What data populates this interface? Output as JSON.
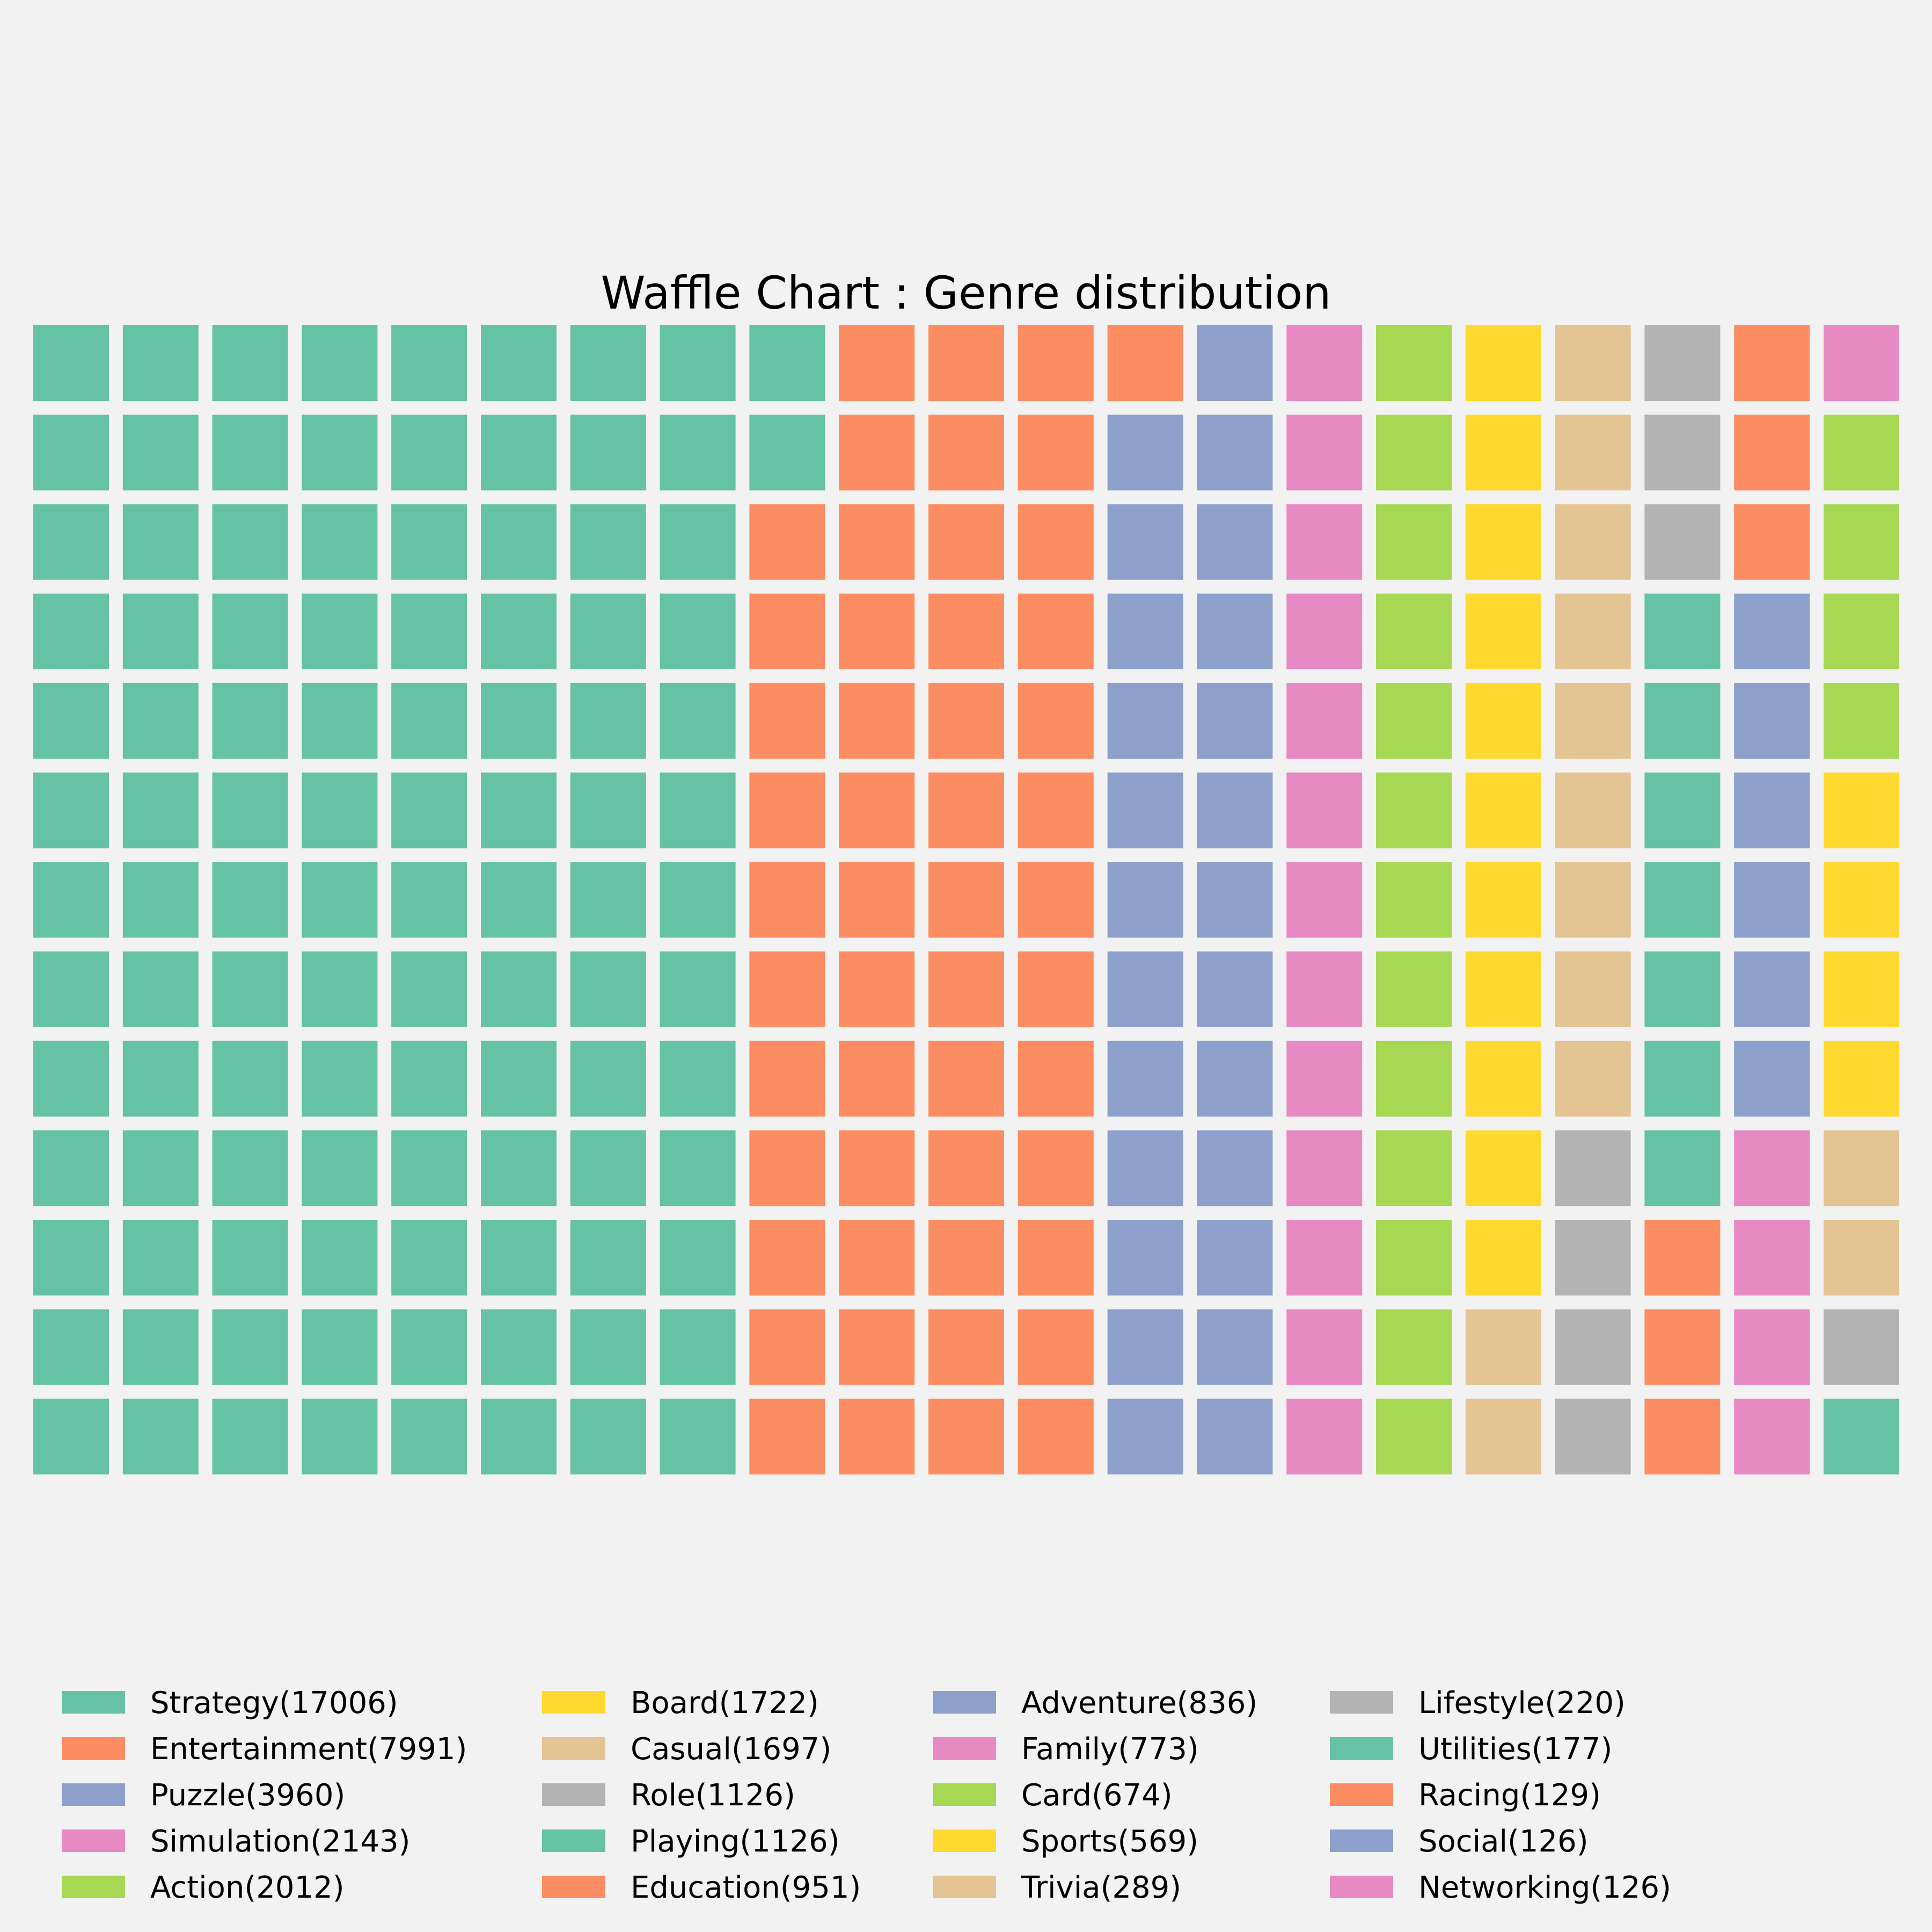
{
  "chart_data": {
    "type": "waffle",
    "title": "Waffle Chart : Genre distribution",
    "rows": 13,
    "columns": 21,
    "fill_order": "column-major, top to bottom",
    "legend_location": "bottom",
    "legend_columns": 4,
    "series": [
      {
        "name": "Strategy(17006)",
        "value": 17006,
        "cells": 106,
        "color": "#66c2a5"
      },
      {
        "name": "Entertainment(7991)",
        "value": 7991,
        "cells": 51,
        "color": "#fc8d62"
      },
      {
        "name": "Puzzle(3960)",
        "value": 3960,
        "cells": 25,
        "color": "#8da0cb"
      },
      {
        "name": "Simulation(2143)",
        "value": 2143,
        "cells": 13,
        "color": "#e78ac3"
      },
      {
        "name": "Action(2012)",
        "value": 2012,
        "cells": 13,
        "color": "#a6d854"
      },
      {
        "name": "Board(1722)",
        "value": 1722,
        "cells": 11,
        "color": "#ffd92f"
      },
      {
        "name": "Casual(1697)",
        "value": 1697,
        "cells": 11,
        "color": "#e5c494"
      },
      {
        "name": "Role(1126)",
        "value": 1126,
        "cells": 7,
        "color": "#b3b3b3"
      },
      {
        "name": "Playing(1126)",
        "value": 1126,
        "cells": 7,
        "color": "#66c2a5"
      },
      {
        "name": "Education(951)",
        "value": 951,
        "cells": 6,
        "color": "#fc8d62"
      },
      {
        "name": "Adventure(836)",
        "value": 836,
        "cells": 6,
        "color": "#8da0cb"
      },
      {
        "name": "Family(773)",
        "value": 773,
        "cells": 5,
        "color": "#e78ac3"
      },
      {
        "name": "Card(674)",
        "value": 674,
        "cells": 4,
        "color": "#a6d854"
      },
      {
        "name": "Sports(569)",
        "value": 569,
        "cells": 4,
        "color": "#ffd92f"
      },
      {
        "name": "Trivia(289)",
        "value": 289,
        "cells": 2,
        "color": "#e5c494"
      },
      {
        "name": "Lifestyle(220)",
        "value": 220,
        "cells": 1,
        "color": "#b3b3b3"
      },
      {
        "name": "Utilities(177)",
        "value": 177,
        "cells": 1,
        "color": "#66c2a5"
      },
      {
        "name": "Racing(129)",
        "value": 129,
        "cells": 0,
        "color": "#fc8d62"
      },
      {
        "name": "Social(126)",
        "value": 126,
        "cells": 0,
        "color": "#8da0cb"
      },
      {
        "name": "Networking(126)",
        "value": 126,
        "cells": 0,
        "color": "#e78ac3"
      }
    ]
  }
}
